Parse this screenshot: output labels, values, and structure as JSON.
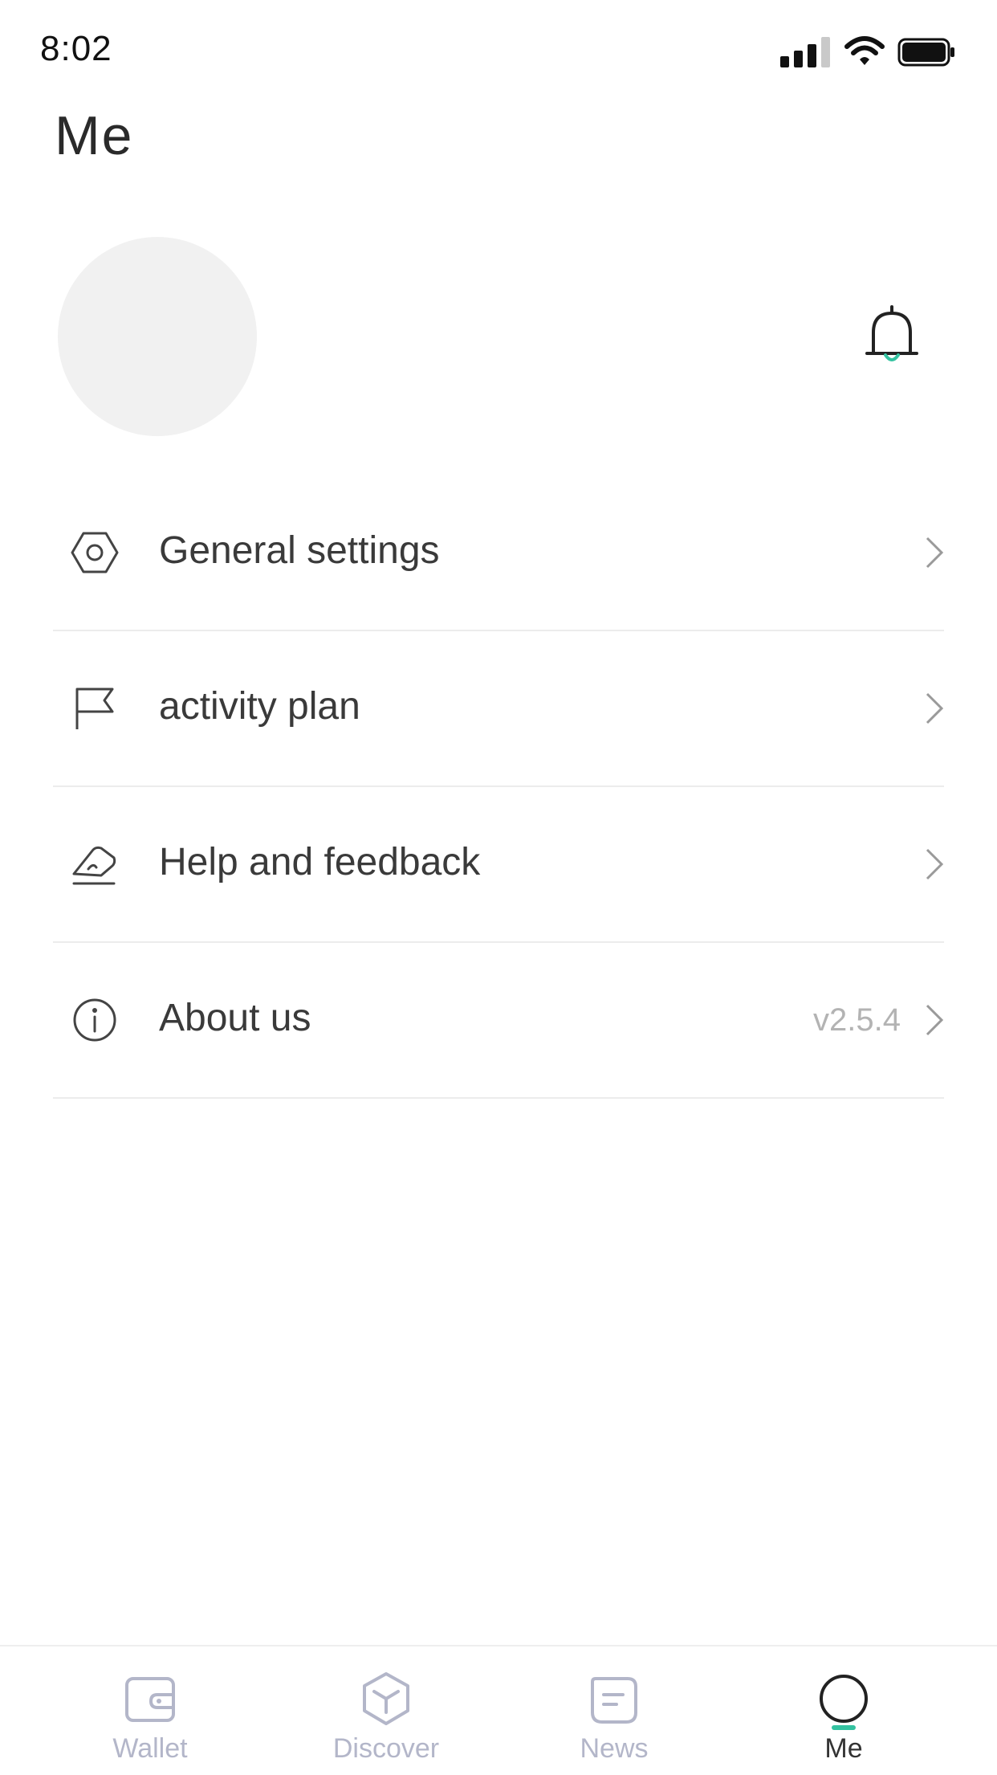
{
  "status_bar": {
    "time": "8:02"
  },
  "header": {
    "title": "Me"
  },
  "profile": {
    "bell_dot_color": "#33c2a0"
  },
  "menu": [
    {
      "id": "general-settings",
      "icon": "hexagon-gear-icon",
      "label": "General settings",
      "value": ""
    },
    {
      "id": "activity-plan",
      "icon": "flag-icon",
      "label": "activity plan",
      "value": ""
    },
    {
      "id": "help-feedback",
      "icon": "pen-feedback-icon",
      "label": "Help and feedback",
      "value": ""
    },
    {
      "id": "about-us",
      "icon": "info-icon",
      "label": "About us",
      "value": "v2.5.4"
    }
  ],
  "tabs": [
    {
      "id": "wallet",
      "icon": "wallet-icon",
      "label": "Wallet",
      "active": false
    },
    {
      "id": "discover",
      "icon": "cube-icon",
      "label": "Discover",
      "active": false
    },
    {
      "id": "news",
      "icon": "news-icon",
      "label": "News",
      "active": false
    },
    {
      "id": "me",
      "icon": "profile-circle-icon",
      "label": "Me",
      "active": true
    }
  ],
  "colors": {
    "accent": "#33c2a0",
    "inactive_tab": "#b3b6c9",
    "text": "#333333"
  }
}
